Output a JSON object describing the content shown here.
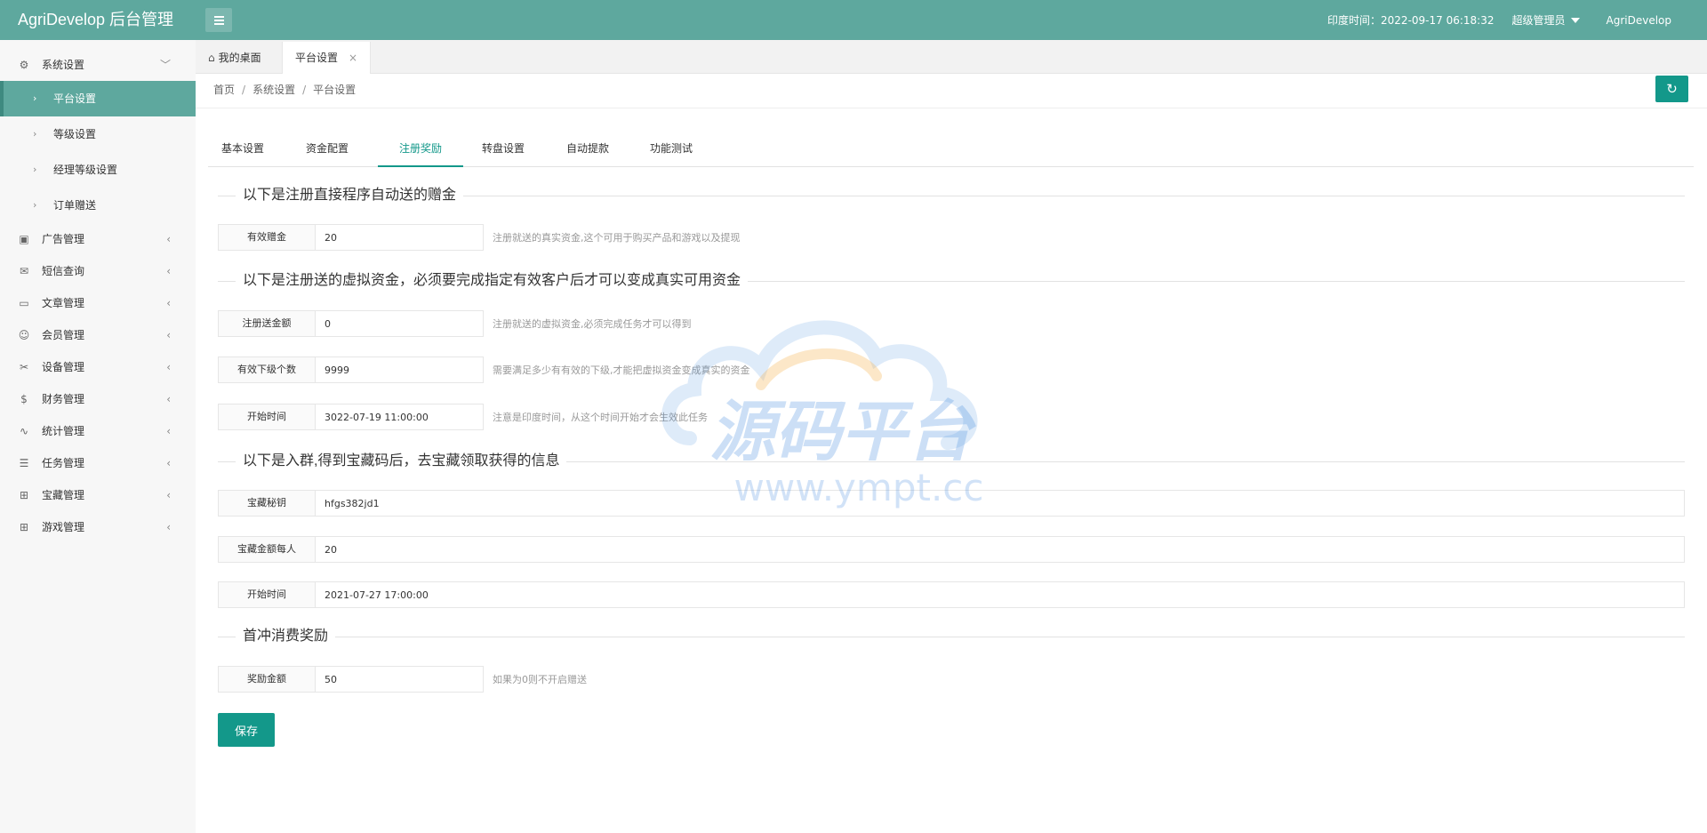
{
  "app": {
    "brand": "AgriDevelop 后台管理",
    "time_text": "印度时间：2022-09-17 06:18:32",
    "role": "超级管理员",
    "username": "AgriDevelop"
  },
  "colors": {
    "header": "#5ea89e",
    "primary": "#13988a",
    "sidebar_bg": "#f7f7f7"
  },
  "sidebar": {
    "system": {
      "label": "系统设置",
      "icon": "gear-icon"
    },
    "system_sub": [
      {
        "label": "平台设置",
        "active": true
      },
      {
        "label": "等级设置"
      },
      {
        "label": "经理等级设置"
      },
      {
        "label": "订单赠送"
      }
    ],
    "items": [
      {
        "label": "广告管理",
        "icon": "image-icon"
      },
      {
        "label": "短信查询",
        "icon": "mail-icon"
      },
      {
        "label": "文章管理",
        "icon": "book-icon"
      },
      {
        "label": "会员管理",
        "icon": "users-icon"
      },
      {
        "label": "设备管理",
        "icon": "tools-icon"
      },
      {
        "label": "财务管理",
        "icon": "dollar-icon"
      },
      {
        "label": "统计管理",
        "icon": "pulse-icon"
      },
      {
        "label": "任务管理",
        "icon": "sliders-icon"
      },
      {
        "label": "宝藏管理",
        "icon": "gift-icon"
      },
      {
        "label": "游戏管理",
        "icon": "gift-icon"
      }
    ]
  },
  "page_tabs": [
    {
      "label": "我的桌面",
      "icon": "home-icon"
    },
    {
      "label": "平台设置",
      "close": "×"
    }
  ],
  "breadcrumb": [
    "首页",
    "系统设置",
    "平台设置"
  ],
  "breadcrumb_sep": "/",
  "settings_tabs": [
    "基本设置",
    "资金配置",
    "注册奖励",
    "转盘设置",
    "自动提款",
    "功能测试"
  ],
  "active_settings_tab": "注册奖励",
  "sections": {
    "s1": "以下是注册直接程序自动送的赠金",
    "s2": "以下是注册送的虚拟资金，必须要完成指定有效客户后才可以变成真实可用资金",
    "s3": "以下是入群,得到宝藏码后，去宝藏领取获得的信息",
    "s4": "首冲消费奖励"
  },
  "fields": {
    "valid_bonus": {
      "label": "有效赠金",
      "value": "20",
      "hint": "注册就送的真实资金,这个可用于购买产品和游戏以及提现"
    },
    "reg_amount": {
      "label": "注册送金额",
      "value": "0",
      "hint": "注册就送的虚拟资金,必须完成任务才可以得到"
    },
    "valid_subs": {
      "label": "有效下级个数",
      "value": "9999",
      "hint": "需要满足多少有有效的下级,才能把虚拟资金变成真实的资金"
    },
    "start_time": {
      "label": "开始时间",
      "value": "3022-07-19 11:00:00",
      "hint": "注意是印度时间，从这个时间开始才会生效此任务"
    },
    "treasure_key": {
      "label": "宝藏秘钥",
      "value": "hfgs382jd1"
    },
    "treasure_amount": {
      "label": "宝藏金额每人",
      "value": "20"
    },
    "treasure_time": {
      "label": "开始时间",
      "value": "2021-07-27 17:00:00"
    },
    "reward_amount": {
      "label": "奖励金额",
      "value": "50",
      "hint": "如果为0则不开启赠送"
    }
  },
  "save_label": "保存",
  "watermark": {
    "title": "源码平台",
    "url": "www.ympt.cc"
  }
}
